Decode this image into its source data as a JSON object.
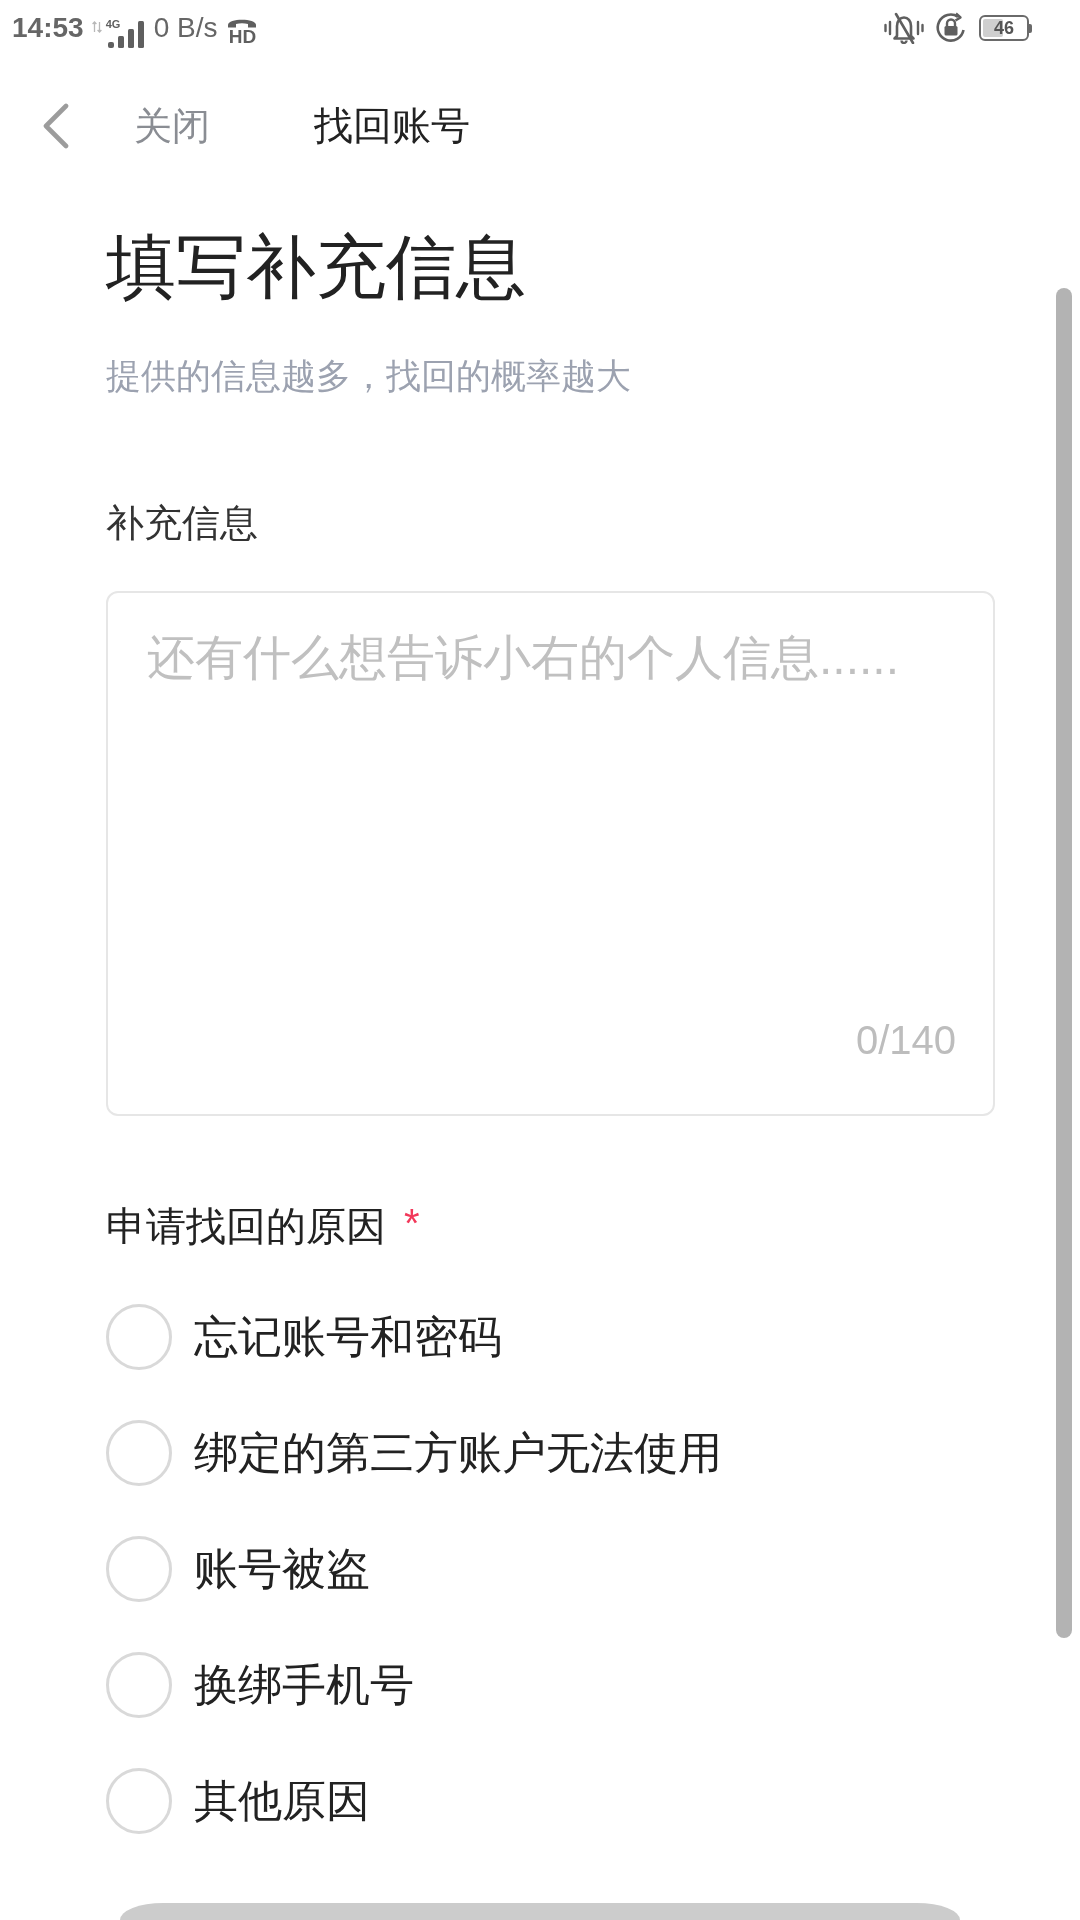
{
  "status_bar": {
    "time": "14:53",
    "network": "4G",
    "speed": "0 B/s",
    "call_label": "HD",
    "battery": "46"
  },
  "nav_bar": {
    "close_label": "关闭",
    "title": "找回账号"
  },
  "header": {
    "title": "填写补充信息",
    "subtitle": "提供的信息越多，找回的概率越大"
  },
  "extra_info": {
    "label": "补充信息",
    "placeholder": "还有什么想告诉小右的个人信息......",
    "counter": "0/140"
  },
  "reason": {
    "label": "申请找回的原因",
    "required_mark": "*",
    "options": [
      {
        "label": "忘记账号和密码",
        "selected": false
      },
      {
        "label": "绑定的第三方账户无法使用",
        "selected": false
      },
      {
        "label": "账号被盗",
        "selected": false
      },
      {
        "label": "换绑手机号",
        "selected": false
      },
      {
        "label": "其他原因",
        "selected": false
      }
    ]
  },
  "submit_button": {
    "disabled": true
  }
}
